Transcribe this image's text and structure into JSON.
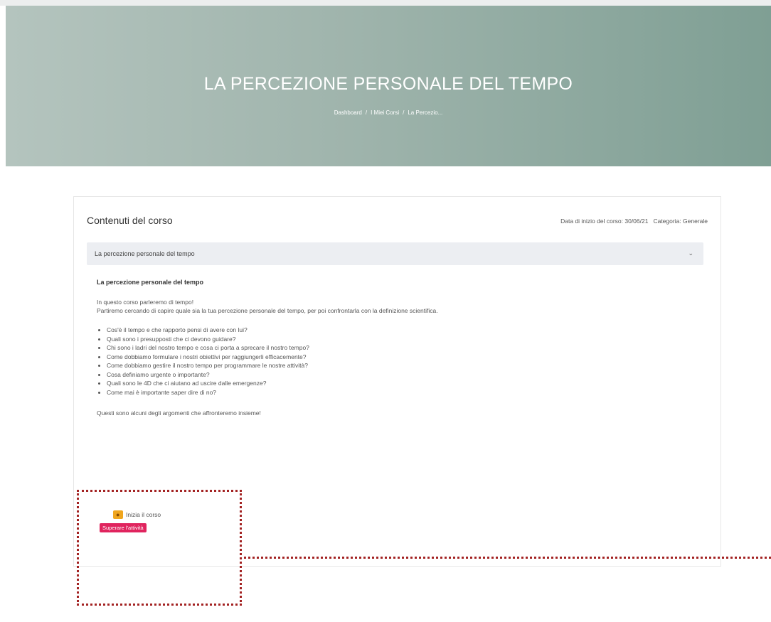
{
  "hero": {
    "title": "LA PERCEZIONE PERSONALE DEL TEMPO",
    "breadcrumb": [
      "Dashboard",
      "I Miei Corsi",
      "La Percezio..."
    ],
    "separator": "/"
  },
  "course": {
    "heading": "Contenuti del corso",
    "start_date": "Data di inizio del corso: 30/06/21",
    "category": "Categoria: Generale",
    "section": {
      "title": "La percezione personale del tempo",
      "subtitle": "La percezione personale del tempo",
      "intro": [
        "In questo corso parleremo di tempo!",
        "Partiremo cercando di capire quale sia la tua percezione personale del tempo, per poi confrontarla con la definizione scientifica."
      ],
      "bullets": [
        "Cos'è il tempo e che rapporto pensi di avere con lui?",
        "Quali sono i presupposti che ci devono guidare?",
        "Chi sono i ladri del nostro tempo e cosa ci porta a sprecare il nostro tempo?",
        "Come dobbiamo formulare i nostri obiettivi per raggiungerli efficacemente?",
        "Come dobbiamo gestire il nostro tempo per programmare le nostre attività?",
        "Cosa definiamo urgente o importante?",
        "Quali sono le 4D che ci aiutano ad uscire dalle emergenze?",
        "Come mai è importante saper dire di no?"
      ],
      "closing": "Questi sono alcuni degli argomenti che affronteremo insieme!"
    },
    "activity": {
      "label": "Inizia il corso",
      "icon": "scorm-package-icon",
      "badge": "Superare l'attività"
    }
  },
  "colors": {
    "hero_gradient_start": "#b4c4be",
    "hero_gradient_end": "#7f9f94",
    "badge": "#e0245e",
    "highlight": "#a32323"
  }
}
